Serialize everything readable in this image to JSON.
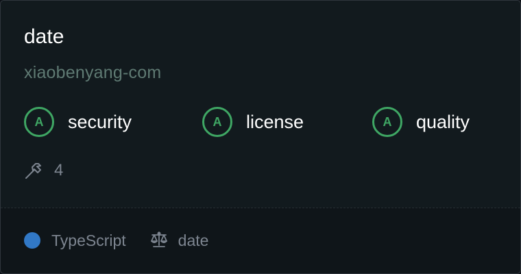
{
  "repo": {
    "name": "date",
    "owner": "xiaobenyang-com"
  },
  "scores": [
    {
      "grade": "A",
      "label": "security"
    },
    {
      "grade": "A",
      "label": "license"
    },
    {
      "grade": "A",
      "label": "quality"
    }
  ],
  "builds": {
    "icon": "hammer-icon",
    "count": "4"
  },
  "footer": {
    "language": "TypeScript",
    "language_color": "#3178c6",
    "license_icon": "scale-icon",
    "license": "date"
  },
  "colors": {
    "grade_accent": "#3fa764",
    "background": "#0d1117"
  }
}
